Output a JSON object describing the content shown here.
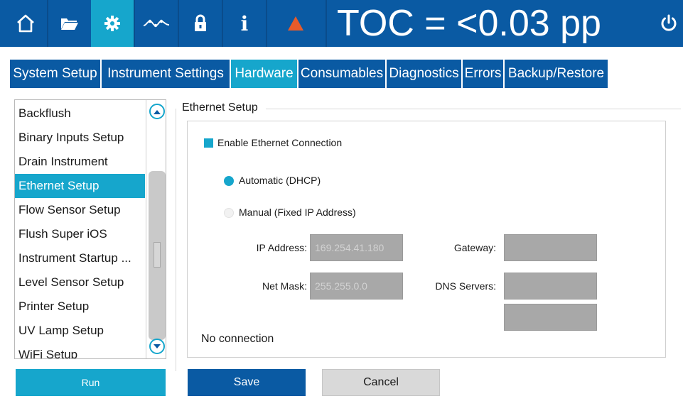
{
  "topbar": {
    "icons": [
      "home-icon",
      "folder-icon",
      "gear-icon",
      "trend-icon",
      "lock-icon",
      "info-icon",
      "warning-icon",
      "power-icon"
    ],
    "info_glyph": "i",
    "toc_readout": "TOC = <0.03 pp",
    "active_icon": "gear-icon",
    "colors": {
      "bar": "#0a5aa3",
      "active": "#16a6cc",
      "warning": "#e85b2a"
    }
  },
  "tabs": [
    {
      "label": "System Setup",
      "active": false
    },
    {
      "label": "Instrument Settings",
      "active": false
    },
    {
      "label": "Hardware",
      "active": true
    },
    {
      "label": "Consumables",
      "active": false
    },
    {
      "label": "Diagnostics",
      "active": false
    },
    {
      "label": "Errors",
      "active": false
    },
    {
      "label": "Backup/Restore",
      "active": false
    }
  ],
  "sidebar": {
    "items": [
      {
        "label": "Backflush"
      },
      {
        "label": "Binary Inputs Setup"
      },
      {
        "label": "Drain Instrument"
      },
      {
        "label": "Ethernet Setup"
      },
      {
        "label": "Flow Sensor Setup"
      },
      {
        "label": "Flush Super iOS"
      },
      {
        "label": "Instrument Startup ..."
      },
      {
        "label": "Level Sensor Setup"
      },
      {
        "label": "Printer Setup"
      },
      {
        "label": "UV Lamp Setup"
      },
      {
        "label": "WiFi Setup"
      }
    ],
    "selected": "Ethernet Setup",
    "run_label": "Run"
  },
  "ethernet": {
    "group_title": "Ethernet Setup",
    "enable_label": "Enable Ethernet Connection",
    "enable_checked": true,
    "automatic_label": "Automatic (DHCP)",
    "automatic_selected": true,
    "manual_label": "Manual (Fixed IP Address)",
    "manual_selected": false,
    "ip_label": "IP Address:",
    "ip_value": "169.254.41.180",
    "mask_label": "Net Mask:",
    "mask_value": "255.255.0.0",
    "gateway_label": "Gateway:",
    "gateway_value": "",
    "dns_label": "DNS Servers:",
    "dns_value_1": "",
    "dns_value_2": "",
    "status": "No connection"
  },
  "actions": {
    "save_label": "Save",
    "cancel_label": "Cancel"
  }
}
